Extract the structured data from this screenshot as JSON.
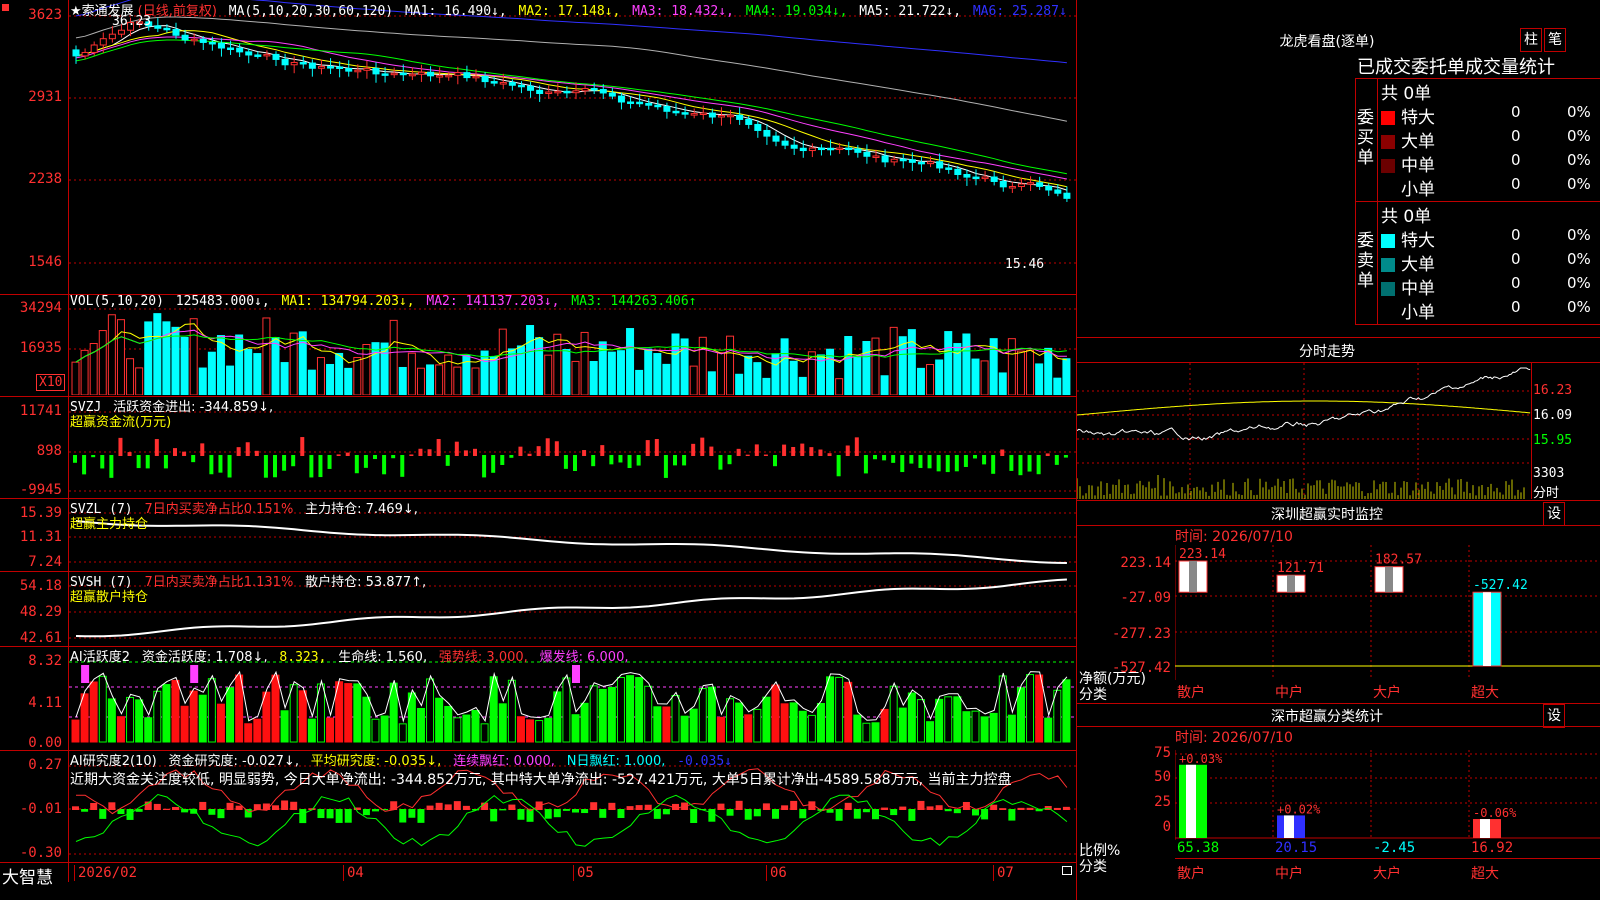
{
  "stock": {
    "name": "★索通发展",
    "period": "(日线,前复权)",
    "high_mark": "36.23",
    "low_mark": "15.46"
  },
  "price_panel": {
    "axis": [
      "3623",
      "2931",
      "2238",
      "1546"
    ],
    "ma_label": "MA(5,10,20,30,60,120)",
    "ma1": "MA1: 16.490↓,",
    "ma2": "MA2: 17.148↓,",
    "ma3": "MA3: 18.432↓,",
    "ma4": "MA4: 19.034↓,",
    "ma5": "MA5: 21.722↓,",
    "ma6": "MA6: 25.287↓"
  },
  "vol_panel": {
    "axis": [
      "34294",
      "16935"
    ],
    "unit_tag": "X10",
    "label": "VOL(5,10,20)",
    "value": "125483.000↓,",
    "ma1": "MA1: 134794.203↓,",
    "ma2": "MA2: 141137.203↓,",
    "ma3": "MA3: 144263.406↑"
  },
  "svzj_panel": {
    "axis": [
      "11741",
      "898",
      "-9945"
    ],
    "label": "SVZJ",
    "desc": "活跃资金进出: -344.859↓,",
    "sub": "超赢资金流(万元)"
  },
  "svzl_panel": {
    "axis": [
      "15.39",
      "11.31",
      "7.24"
    ],
    "label": "SVZL (7)",
    "ratio": "7日内买卖净占比0.151%",
    "hold": "主力持仓: 7.469↓,",
    "sub": "超赢主力持仓"
  },
  "svsh_panel": {
    "axis": [
      "54.18",
      "48.29",
      "42.61"
    ],
    "label": "SVSH (7)",
    "ratio": "7日内买卖净占比1.131%",
    "hold": "散户持仓: 53.877↑,",
    "sub": "超赢散户持仓"
  },
  "ai_active_panel": {
    "axis": [
      "8.32",
      "4.11",
      "0.00"
    ],
    "label": "AI活跃度2",
    "v1": "资金活跃度: 1.708↓,",
    "v2": "8.323,",
    "v3": "生命线: 1.560,",
    "v4": "强势线: 3.000,",
    "v5": "爆发线: 6.000,"
  },
  "ai_research_panel": {
    "axis": [
      "0.27",
      "-0.01",
      "-0.30"
    ],
    "label": "AI研究度2(10)",
    "v1": "资金研究度: -0.027↓,",
    "v2": "平均研究度: -0.035↓,",
    "v3": "连续飘红: 0.000,",
    "v4": "N日飘红: 1.000,",
    "v5": "-0.035↓",
    "comment": "近期大资金关注度较低, 明显弱势, 今日大单净流出: -344.852万元, 其中特大单净流出: -527.421万元, 大单5日累计净出-4589.588万元, 当前主力控盘"
  },
  "time_axis": {
    "brand": "大智慧",
    "labels": [
      "2026/02",
      "04",
      "05",
      "06",
      "07"
    ]
  },
  "right": {
    "lhb_title": "龙虎看盘(逐单)",
    "btn_zhu": "柱",
    "btn_bi": "笔",
    "tabs": "已成交委托单成交量统计",
    "buy": {
      "label": "委买单",
      "total": "共 0单",
      "rows": [
        {
          "name": "特大",
          "count": "0",
          "pct": "0%",
          "color": "#ff0000"
        },
        {
          "name": "大单",
          "count": "0",
          "pct": "0%",
          "color": "#8b0000"
        },
        {
          "name": "中单",
          "count": "0",
          "pct": "0%",
          "color": "#6b0000"
        },
        {
          "name": "小单",
          "count": "0",
          "pct": "0%",
          "color": "#000000"
        }
      ]
    },
    "sell": {
      "label": "委卖单",
      "total": "共 0单",
      "rows": [
        {
          "name": "特大",
          "count": "0",
          "pct": "0%",
          "color": "#00ffff"
        },
        {
          "name": "大单",
          "count": "0",
          "pct": "0%",
          "color": "#008b8b"
        },
        {
          "name": "中单",
          "count": "0",
          "pct": "0%",
          "color": "#007070"
        },
        {
          "name": "小单",
          "count": "0",
          "pct": "0%",
          "color": "#000000"
        }
      ]
    },
    "intraday": {
      "title": "分时走势",
      "axis": [
        "16.23",
        "16.09",
        "15.95"
      ],
      "vol_label": "3303",
      "vol_sub": "分时"
    },
    "monitor": {
      "title": "深圳超赢实时监控",
      "btn": "设",
      "time": "时间: 2026/07/10",
      "axis": [
        "223.14",
        "-27.09",
        "-277.23",
        "-527.42"
      ],
      "left_lbl1": "净额(万元)",
      "left_lbl2": "分类",
      "chart_data": {
        "type": "bar",
        "categories": [
          "散户",
          "中户",
          "大户",
          "超大"
        ],
        "values": [
          223.14,
          121.71,
          182.57,
          -527.42
        ],
        "ylim": [
          -527.42,
          223.14
        ]
      }
    },
    "classify": {
      "title": "深市超赢分类统计",
      "btn": "设",
      "time": "时间: 2026/07/10",
      "axis": [
        "75",
        "50",
        "25",
        "0"
      ],
      "left_lbl1": "比例%",
      "left_lbl2": "分类",
      "chart_data": {
        "type": "bar",
        "categories": [
          "散户",
          "中户",
          "大户",
          "超大"
        ],
        "values": [
          65.38,
          20.15,
          -2.45,
          16.92
        ],
        "bar_labels": [
          "+0.03%",
          "+0.02%",
          "",
          "-0.06%"
        ],
        "ylim": [
          0,
          75
        ]
      }
    }
  }
}
